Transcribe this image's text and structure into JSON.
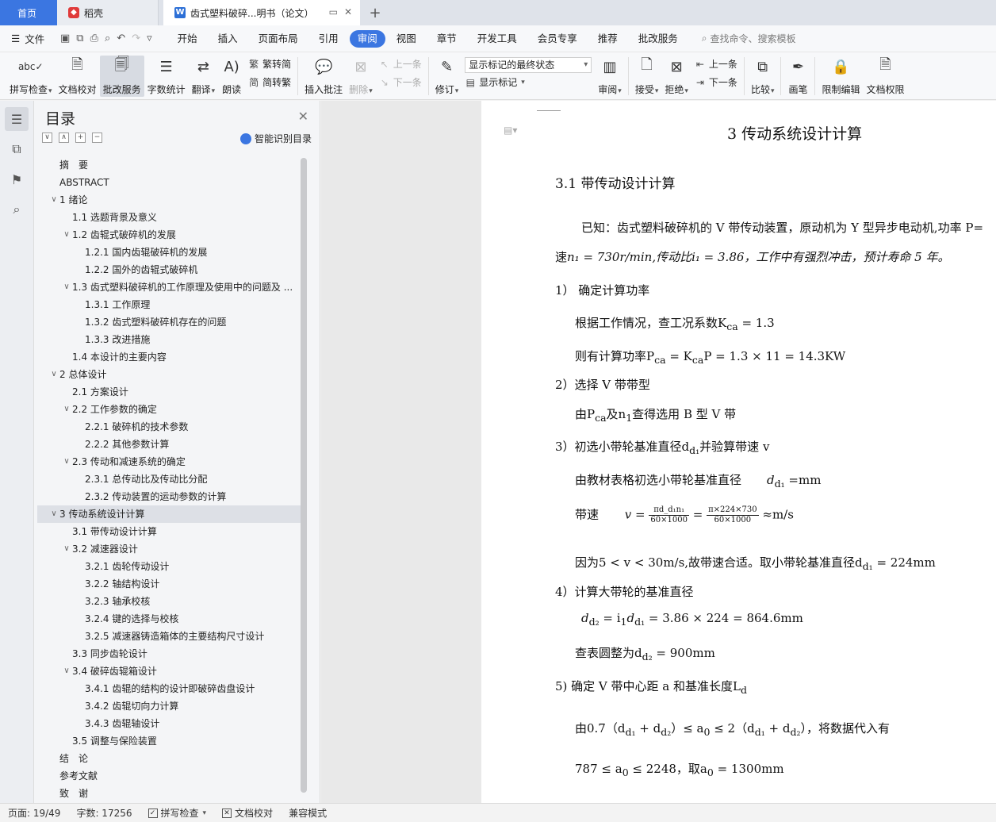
{
  "tabs": {
    "home": "首页",
    "daoke": "稻壳",
    "doc": "齿式塑料破碎...明书（论文）"
  },
  "menu": {
    "file": "文件",
    "tabs": [
      "开始",
      "插入",
      "页面布局",
      "引用",
      "审阅",
      "视图",
      "章节",
      "开发工具",
      "会员专享",
      "推荐",
      "批改服务"
    ],
    "active_tab": "审阅",
    "search": "查找命令、搜索模板"
  },
  "ribbon": {
    "spell": "拼写检查",
    "proof": "文档校对",
    "correct": "批改服务",
    "wordcount": "字数统计",
    "translate": "翻译",
    "read": "朗读",
    "trad": "繁转简",
    "simp": "简转繁",
    "insert_comment": "插入批注",
    "delete": "删除",
    "prev": "上一条",
    "next": "下一条",
    "revise": "修订",
    "show_final": "显示标记的最终状态",
    "show_marks": "显示标记",
    "review": "审阅",
    "accept": "接受",
    "reject": "拒绝",
    "prev2": "上一条",
    "next2": "下一条",
    "compare": "比较",
    "pen": "画笔",
    "restrict": "限制编辑",
    "perm": "文档权限"
  },
  "toc": {
    "title": "目录",
    "smart": "智能识别目录",
    "items": [
      {
        "text": "摘　要",
        "level": 0,
        "tog": ""
      },
      {
        "text": "ABSTRACT",
        "level": 0,
        "tog": ""
      },
      {
        "text": "1  绪论",
        "level": 0,
        "tog": "∨"
      },
      {
        "text": "1.1 选题背景及意义",
        "level": 1,
        "tog": ""
      },
      {
        "text": "1.2 齿辊式破碎机的发展",
        "level": 1,
        "tog": "∨"
      },
      {
        "text": "1.2.1 国内齿辊破碎机的发展",
        "level": 2,
        "tog": ""
      },
      {
        "text": "1.2.2 国外的齿辊式破碎机",
        "level": 2,
        "tog": ""
      },
      {
        "text": "1.3 齿式塑料破碎机的工作原理及使用中的问题及 ...",
        "level": 1,
        "tog": "∨"
      },
      {
        "text": "1.3.1 工作原理",
        "level": 2,
        "tog": ""
      },
      {
        "text": "1.3.2 齿式塑料破碎机存在的问题",
        "level": 2,
        "tog": ""
      },
      {
        "text": "1.3.3 改进措施",
        "level": 2,
        "tog": ""
      },
      {
        "text": "1.4 本设计的主要内容",
        "level": 1,
        "tog": ""
      },
      {
        "text": "2  总体设计",
        "level": 0,
        "tog": "∨"
      },
      {
        "text": "2.1 方案设计",
        "level": 1,
        "tog": ""
      },
      {
        "text": "2.2 工作参数的确定",
        "level": 1,
        "tog": "∨"
      },
      {
        "text": "2.2.1 破碎机的技术参数",
        "level": 2,
        "tog": ""
      },
      {
        "text": "2.2.2 其他参数计算",
        "level": 2,
        "tog": ""
      },
      {
        "text": "2.3 传动和减速系统的确定",
        "level": 1,
        "tog": "∨"
      },
      {
        "text": "2.3.1 总传动比及传动比分配",
        "level": 2,
        "tog": ""
      },
      {
        "text": "2.3.2 传动装置的运动参数的计算",
        "level": 2,
        "tog": ""
      },
      {
        "text": "3  传动系统设计计算",
        "level": 0,
        "tog": "∨"
      },
      {
        "text": "3.1  带传动设计计算",
        "level": 1,
        "tog": ""
      },
      {
        "text": "3.2 减速器设计",
        "level": 1,
        "tog": "∨"
      },
      {
        "text": "3.2.1 齿轮传动设计",
        "level": 2,
        "tog": ""
      },
      {
        "text": "3.2.2 轴结构设计",
        "level": 2,
        "tog": ""
      },
      {
        "text": "3.2.3 轴承校核",
        "level": 2,
        "tog": ""
      },
      {
        "text": "3.2.4 键的选择与校核",
        "level": 2,
        "tog": ""
      },
      {
        "text": "3.2.5 减速器铸造箱体的主要结构尺寸设计",
        "level": 2,
        "tog": ""
      },
      {
        "text": "3.3 同步齿轮设计",
        "level": 1,
        "tog": ""
      },
      {
        "text": "3.4 破碎齿辊箱设计",
        "level": 1,
        "tog": "∨"
      },
      {
        "text": "3.4.1 齿辊的结构的设计即破碎齿盘设计",
        "level": 2,
        "tog": ""
      },
      {
        "text": "3.4.2 齿辊切向力计算",
        "level": 2,
        "tog": ""
      },
      {
        "text": "3.4.3 齿辊轴设计",
        "level": 2,
        "tog": ""
      },
      {
        "text": "3.5 调整与保险装置",
        "level": 1,
        "tog": ""
      },
      {
        "text": "结　论",
        "level": 0,
        "tog": ""
      },
      {
        "text": "参考文献",
        "level": 0,
        "tog": ""
      },
      {
        "text": "致　谢",
        "level": 0,
        "tog": ""
      }
    ],
    "selected_index": 20
  },
  "doc": {
    "chapter": "3  传动系统设计计算",
    "section": "3.1  带传动设计计算",
    "l1": "已知：齿式塑料破碎机的 V 带传动装置，原动机为 Y 型异步电动机,功率 P=",
    "l2a": "速",
    "l2b": "n₁ = 730r/min,传动比i₁ = 3.86，工作中有强烈冲击，预计寿命 5 年。",
    "s1": "1）  确定计算功率",
    "s1a": "根据工作情况，查工况系数K",
    "s1a_sub": "ca",
    "s1a_tail": " = 1.3",
    "s1b": "则有计算功率P",
    "s1b_sub1": "ca",
    "s1b_mid": " = K",
    "s1b_sub2": "ca",
    "s1b_tail": "P = 1.3 × 11 = 14.3KW",
    "s2": "2）选择 V 带带型",
    "s2a_1": "由P",
    "s2a_sub1": "ca",
    "s2a_2": "及n",
    "s2a_sub2": "1",
    "s2a_3": "查得选用 B 型 V 带",
    "s3": "3）初选小带轮基准直径d",
    "s3_sub": "d₁",
    "s3_tail": "并验算带速 v",
    "s3a": "由教材表格初选小带轮基准直径",
    "s3a_var": "d",
    "s3a_sub": "d₁",
    "s3a_tail": " =mm",
    "s3b": "带速",
    "s3b_v": "v =",
    "s3b_num1": "πd_d₁n₁",
    "s3b_den1": "60×1000",
    "s3b_eq": " = ",
    "s3b_num2": "π×224×730",
    "s3b_den2": "60×1000",
    "s3b_tail": " ≈m/s",
    "s3c": "因为5 < v < 30m/s,故带速合适。取小带轮基准直径d",
    "s3c_sub": "d₁",
    "s3c_tail": " = 224mm",
    "s4": "4）计算大带轮的基准直径",
    "s4a_1": "d",
    "s4a_sub1": "d₂",
    "s4a_2": " = i",
    "s4a_sub2": "1",
    "s4a_3": "d",
    "s4a_sub3": "d₁",
    "s4a_4": " = 3.86 × 224 = 864.6mm",
    "s4b": "查表圆整为d",
    "s4b_sub": "d₂",
    "s4b_tail": " = 900mm",
    "s5": "5) 确定 V 带中心距 a 和基准长度L",
    "s5_sub": "d",
    "s5a": "由0.7（d",
    "s5a_s1": "d₁",
    "s5a_2": " + d",
    "s5a_s2": "d₂",
    "s5a_3": "）≤ a",
    "s5a_s3": "0",
    "s5a_4": " ≤ 2（d",
    "s5a_s4": "d₁",
    "s5a_5": " + d",
    "s5a_s5": "d₂",
    "s5a_6": "），将数据代入有",
    "s5b_1": "787 ≤ a",
    "s5b_s1": "0",
    "s5b_2": " ≤ 2248，取a",
    "s5b_s2": "0",
    "s5b_3": " = 1300mm"
  },
  "status": {
    "page": "页面: 19/49",
    "words": "字数: 17256",
    "spell": "拼写检查",
    "proof": "文档校对",
    "compat": "兼容模式"
  },
  "colors": {
    "accent": "#3b76e1",
    "tabbar": "#dfe3ea"
  }
}
